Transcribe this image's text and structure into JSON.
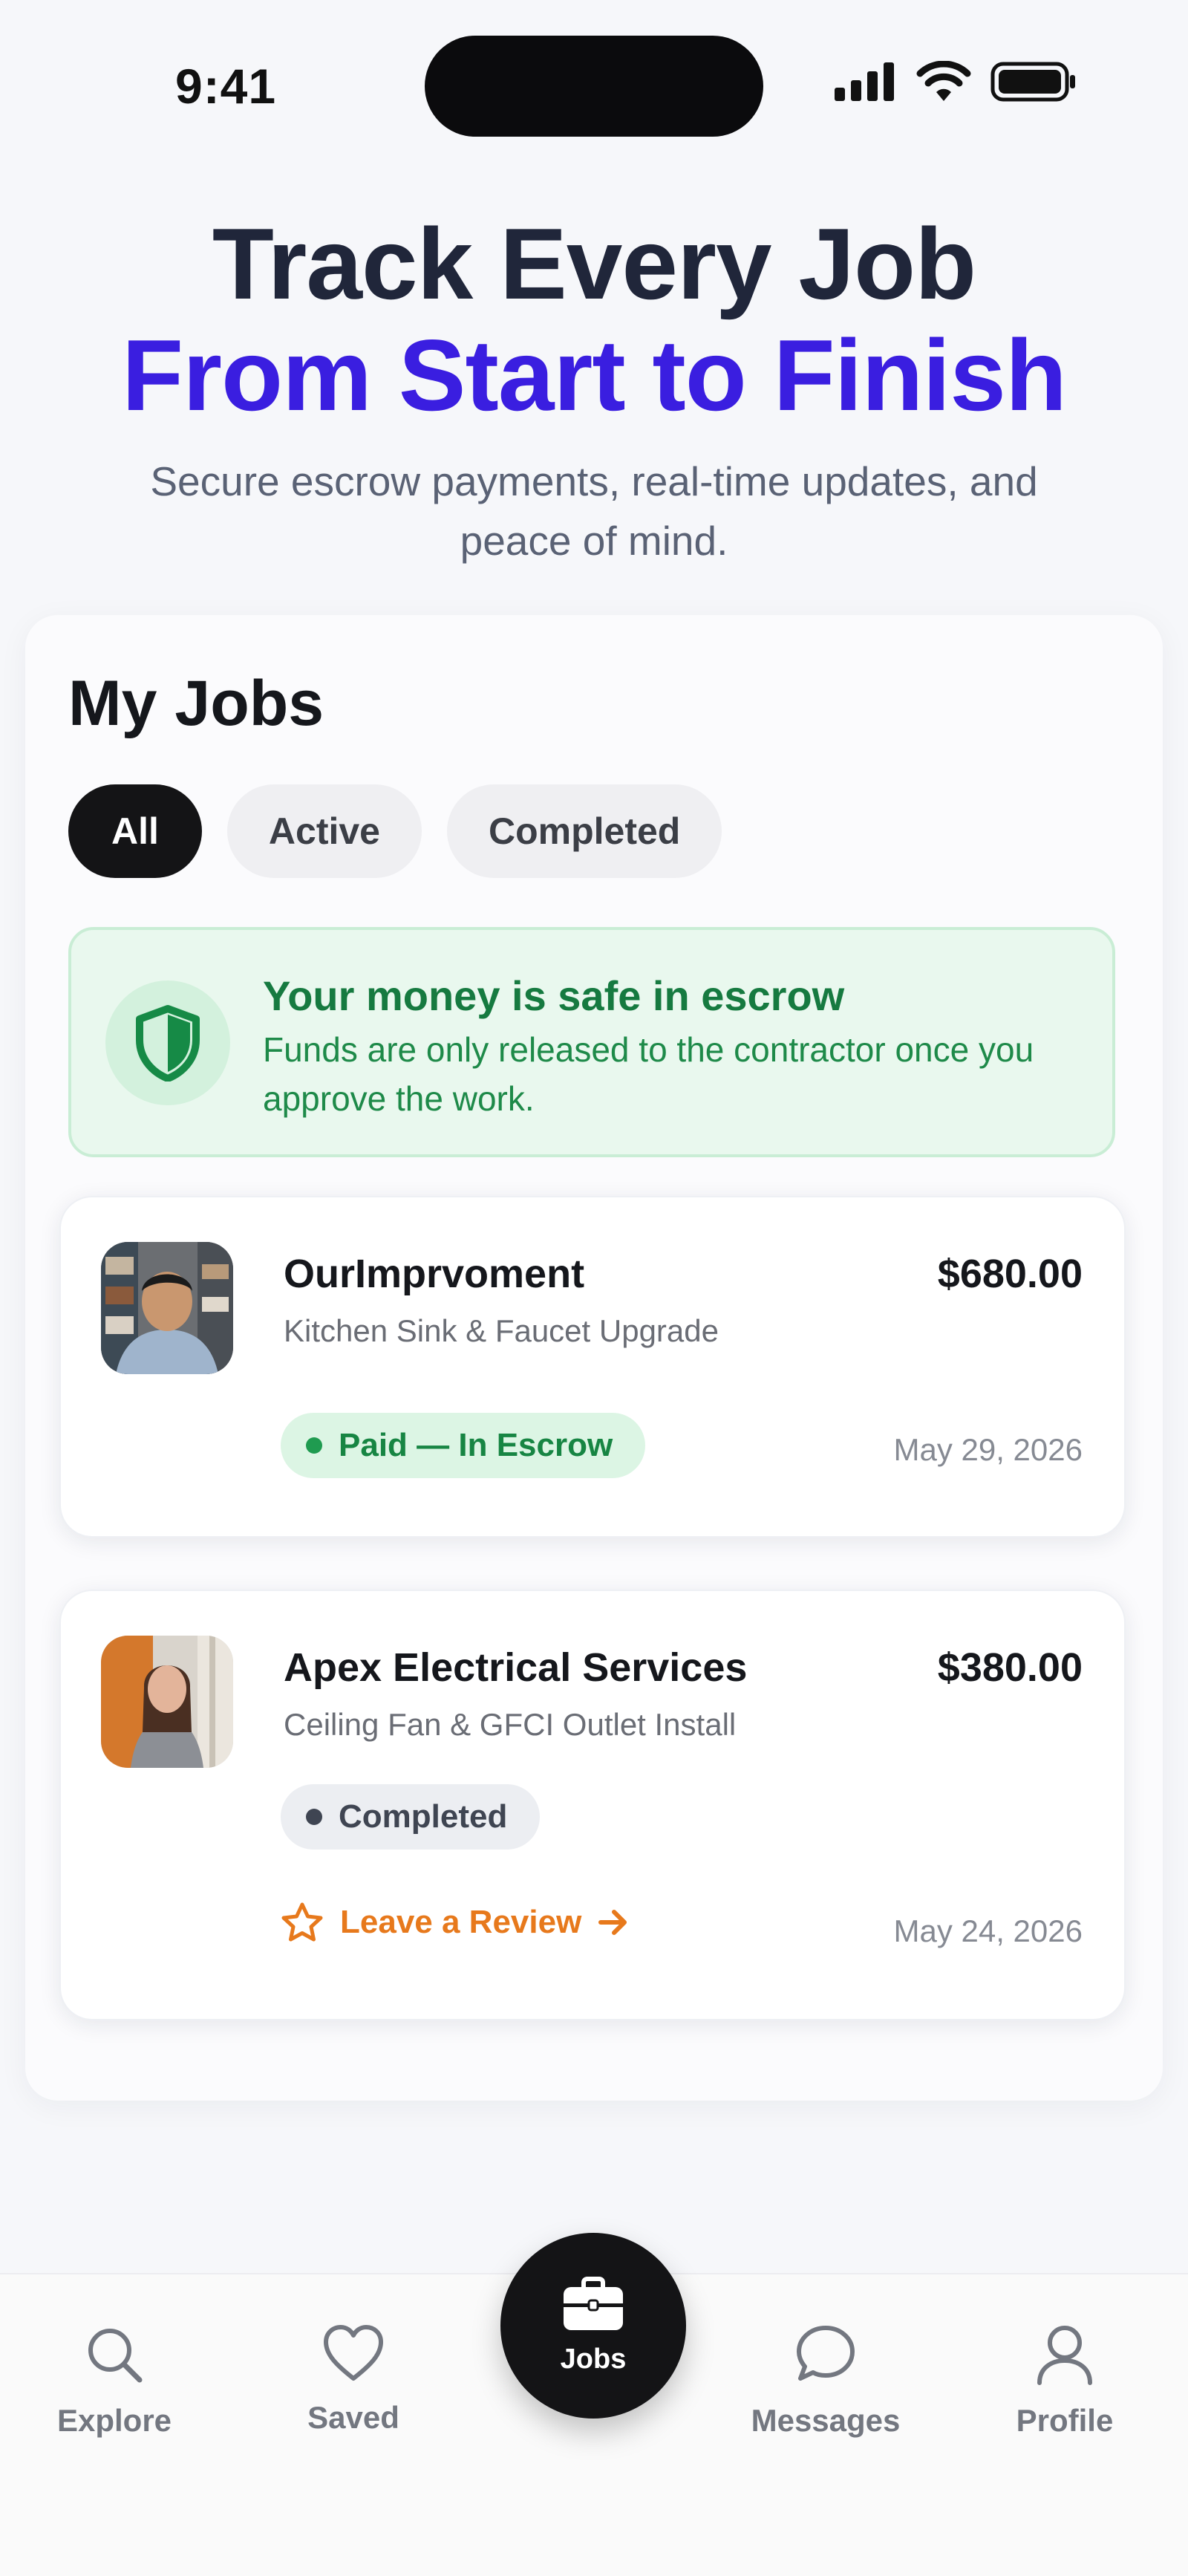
{
  "status_bar": {
    "time": "9:41"
  },
  "hero": {
    "line1": "Track Every Job",
    "line2": "From Start to Finish",
    "subtitle": "Secure escrow payments, real-time updates, and peace of mind."
  },
  "jobs": {
    "title": "My Jobs",
    "filters": [
      "All",
      "Active",
      "Completed"
    ],
    "selected_filter": "All",
    "escrow_notice": {
      "title": "Your money is safe in escrow",
      "body": "Funds are only released to the contractor once you approve the work.",
      "icon": "shield-icon"
    },
    "items": [
      {
        "company": "OurImprvoment",
        "service": "Kitchen Sink & Faucet Upgrade",
        "price": "$680.00",
        "status": "Paid — In Escrow",
        "date": "May 29, 2026"
      },
      {
        "company": "Apex Electrical Services",
        "service": "Ceiling Fan & GFCI Outlet Install",
        "price": "$380.00",
        "status": "Completed",
        "date": "May 24, 2026",
        "review_label": "Leave a Review"
      }
    ]
  },
  "nav": {
    "explore": "Explore",
    "saved": "Saved",
    "jobs": "Jobs",
    "messages": "Messages",
    "profile": "Profile",
    "active": "Jobs"
  },
  "colors": {
    "accent": "#3a1ee0",
    "heading": "#20263a",
    "escrow_green": "#167a40",
    "review_orange": "#e7791c"
  }
}
